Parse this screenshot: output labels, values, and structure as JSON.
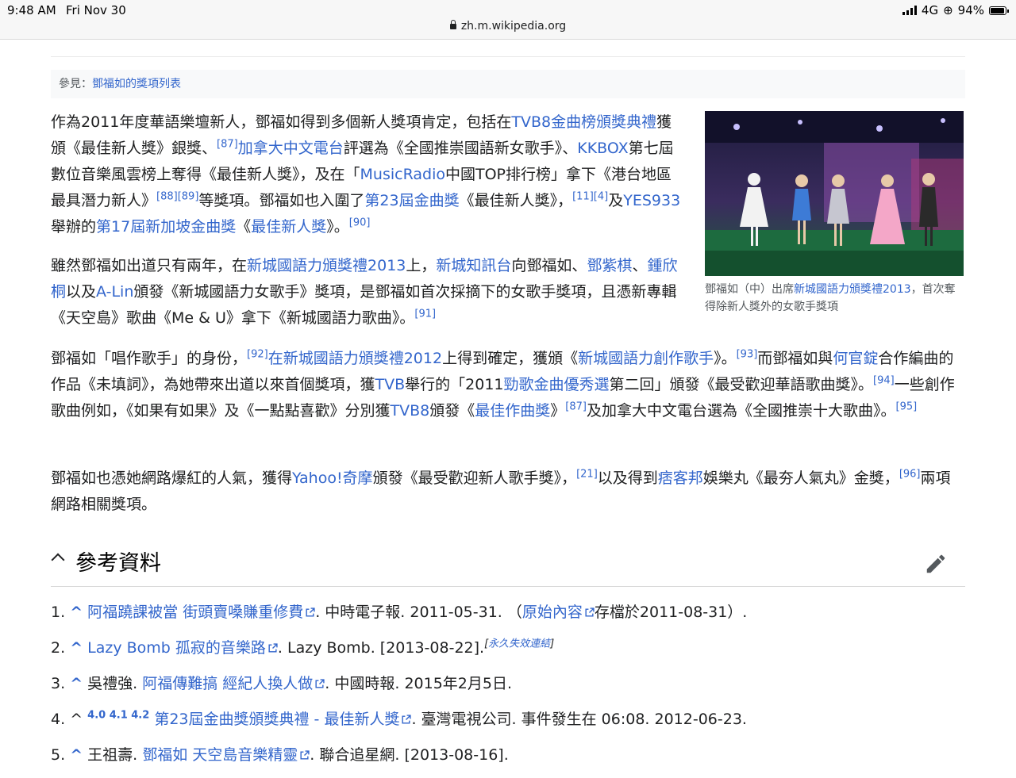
{
  "status_bar": {
    "time": "9:48 AM",
    "date": "Fri Nov 30",
    "network": "4G",
    "battery": "94%"
  },
  "url": "zh.m.wikipedia.org",
  "see_also": {
    "label": "參見：",
    "link": "鄧福如的獎項列表"
  },
  "p1": {
    "t1": "作為2011年度華語樂壇新人，鄧福如得到多個新人獎項肯定，包括在",
    "l1": "TVB8金曲榜頒獎典禮",
    "t2": "獲頒《最佳新人獎》銀獎、",
    "s1": "[87]",
    "l2": "加拿大中文電台",
    "t3": "評選為《全國推崇國語新女歌手》、",
    "l3": "KKBOX",
    "t4": "第七屆數位音樂風雲榜上奪得《最佳新人獎》，及在「",
    "l4": "MusicRadio",
    "t5": "中國TOP排行榜」拿下《港台地區最具潛力新人》",
    "s2": "[88][89]",
    "t6": "等獎項。鄧福如也入圍了",
    "l5": "第23屆金曲獎",
    "t7": "《最佳新人獎》，",
    "s3": "[11][4]",
    "t8": "及",
    "l6": "YES933",
    "t9": "舉辦的",
    "l7": "第17屆新加坡金曲獎",
    "t10": "《",
    "l8": "最佳新人獎",
    "t11": "》。",
    "s4": "[90]"
  },
  "p2": {
    "t1": "雖然鄧福如出道只有兩年，在",
    "l1": "新城國語力頒獎禮2013",
    "t2": "上，",
    "l2": "新城知訊台",
    "t3": "向鄧福如、",
    "l3": "鄧紫棋",
    "t4": "、",
    "l4": "鍾欣桐",
    "t5": "以及",
    "l5": "A-Lin",
    "t6": "頒發《新城國語力女歌手》獎項，是鄧福如首次採摘下的女歌手獎項，且憑新專輯《天空島》歌曲《Me & U》拿下《新城國語力歌曲》。",
    "s1": "[91]"
  },
  "figure": {
    "caption_before": "鄧福如（中）出席",
    "caption_link": "新城國語力頒獎禮2013",
    "caption_after": "，首次奪得除新人獎外的女歌手獎項"
  },
  "p3": {
    "t1": "鄧福如「唱作歌手」的身份，",
    "s1": "[92]",
    "l1": "在新城國語力頒獎禮2012",
    "t2": "上得到確定，獲頒《",
    "l2": "新城國語力創作歌手",
    "t3": "》。",
    "s2": "[93]",
    "t4": "而鄧福如與",
    "l3": "何官錠",
    "t5": "合作編曲的作品《未填詞》，為她帶來出道以來首個獎項，獲",
    "l4": "TVB",
    "t6": "舉行的「2011",
    "l5": "勁歌金曲優秀選",
    "t7": "第二回」頒發《最受歡迎華語歌曲獎》。",
    "s3": "[94]",
    "t8": "一些創作歌曲例如，《如果有如果》及《一點點喜歡》分別獲",
    "l6": "TVB8",
    "t9": "頒發《",
    "l7": "最佳作曲獎",
    "t10": "》",
    "s4": "[87]",
    "t11": "及加拿大中文電台選為《全國推崇十大歌曲》。",
    "s5": "[95]"
  },
  "p4": {
    "t1": "鄧福如也憑她網路爆紅的人氣，獲得",
    "l1": "Yahoo!奇摩",
    "t2": "頒發《最受歡迎新人歌手獎》，",
    "s1": "[21]",
    "t3": "以及得到",
    "l2": "痞客邦",
    "t4": "娛樂丸《最夯人氣丸》金獎，",
    "s2": "[96]",
    "t5": "兩項網路相關獎項。"
  },
  "references": {
    "heading": "參考資料",
    "items": [
      {
        "num": "1.",
        "caret": "^",
        "link": "阿福蹺課被當 街頭賣嗓賺重修費",
        "after": ". 中時電子報. 2011-05-31. （",
        "link2": "原始內容",
        "after2": "存檔於2011-08-31）."
      },
      {
        "num": "2.",
        "caret": "^",
        "link": "Lazy Bomb 孤寂的音樂路",
        "after": ". Lazy Bomb. [2013-08-22].",
        "dead_open": "[",
        "dead_link": "永久失效連結",
        "dead_close": "]"
      },
      {
        "num": "3.",
        "caret": "^",
        "before": "吳禮強. ",
        "link": "阿福傳難搞 經紀人換人做",
        "after": ". 中國時報. 2015年2月5日."
      },
      {
        "num": "4.",
        "caret": "^",
        "backrefs": "4.0 4.1 4.2",
        "link": "第23屆金曲獎頒獎典禮 - 最佳新人獎",
        "after": ". 臺灣電視公司. 事件發生在 06:08. 2012-06-23."
      },
      {
        "num": "5.",
        "caret": "^",
        "before": "王祖壽. ",
        "link": "鄧福如 天空島音樂精靈",
        "after": ". 聯合追星網. [2013-08-16]."
      }
    ]
  }
}
